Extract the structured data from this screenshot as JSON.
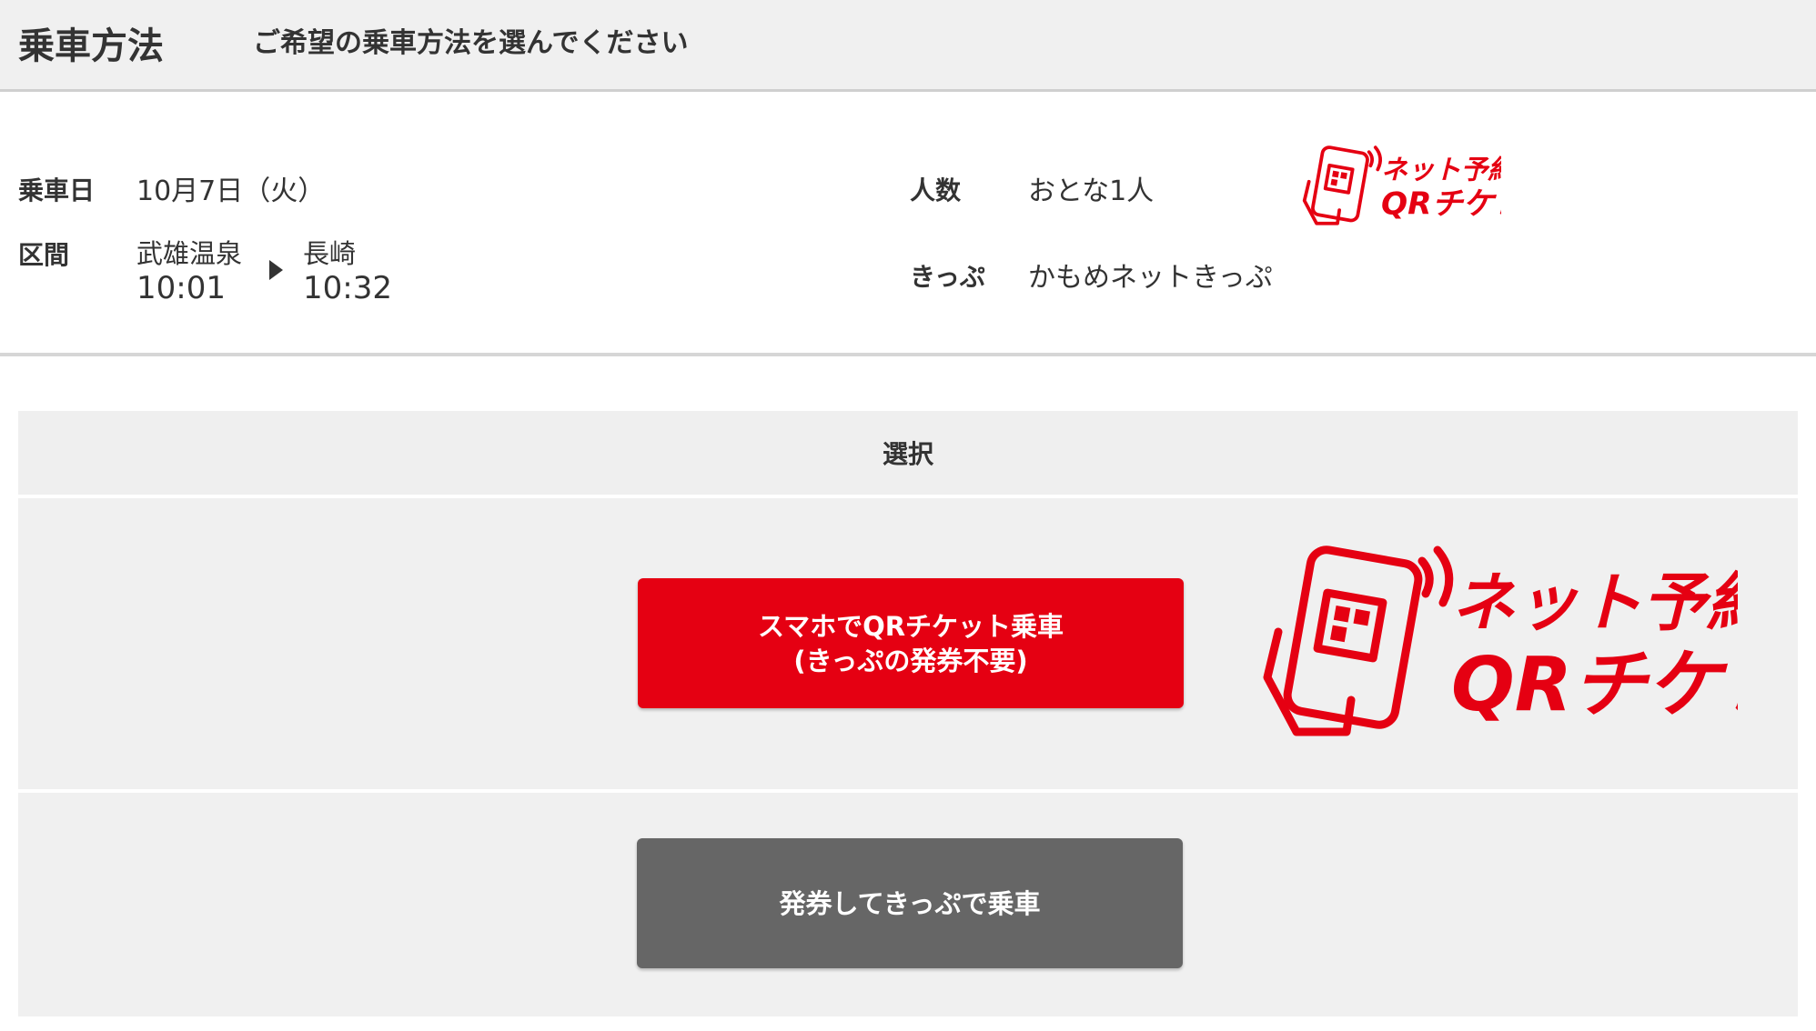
{
  "header": {
    "title": "乗車方法",
    "subtitle": "ご希望の乗車方法を選んでください"
  },
  "info": {
    "date_label": "乗車日",
    "date_value": "10月7日（火）",
    "section_label": "区間",
    "from_station": "武雄温泉",
    "from_time": "10:01",
    "to_station": "長崎",
    "to_time": "10:32",
    "people_label": "人数",
    "people_value": "おとな1人",
    "ticket_label": "きっぷ",
    "ticket_value": "かもめネットきっぷ"
  },
  "logo": {
    "line1": "ネット予約で",
    "line2": "QRチケレス",
    "color": "#e50012"
  },
  "table": {
    "header": "選択",
    "qr_button_line1": "スマホでQRチケット乗車",
    "qr_button_line2": "(きっぷの発券不要)",
    "ticket_button": "発券してきっぷで乗車"
  },
  "colors": {
    "accent_red": "#e50012",
    "secondary_gray": "#666666",
    "background_gray": "#f0f0f0"
  }
}
